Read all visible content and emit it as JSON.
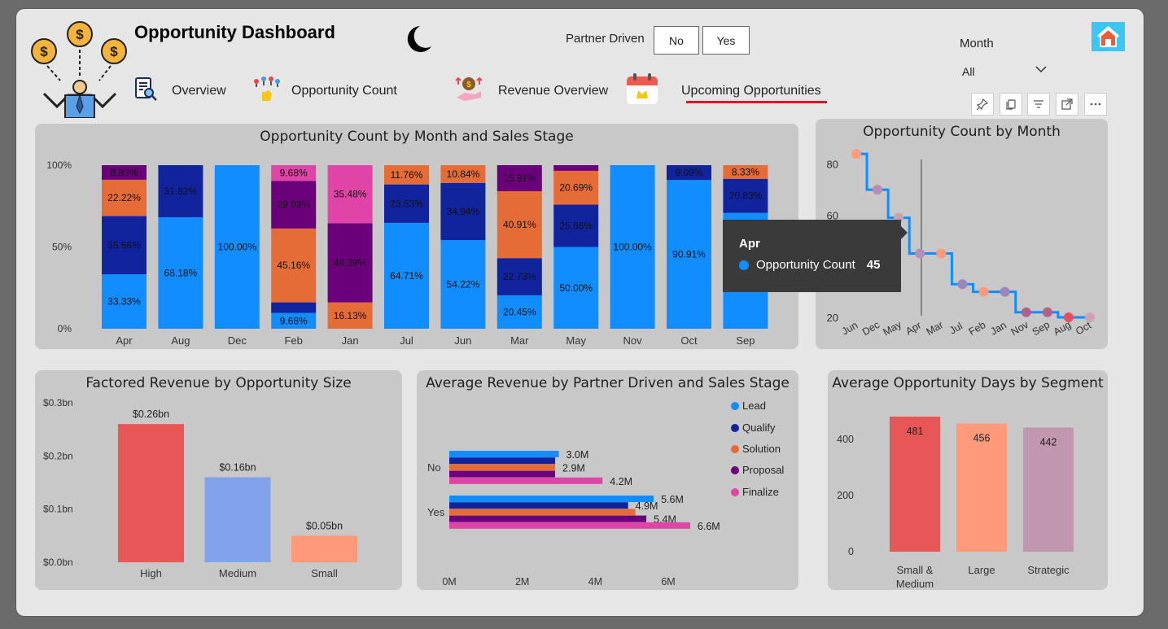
{
  "header": {
    "title": "Opportunity Dashboard",
    "partner_label": "Partner Driven",
    "partner_options": [
      "No",
      "Yes"
    ],
    "month_label": "Month",
    "month_value": "All"
  },
  "nav": {
    "items": [
      {
        "label": "Overview"
      },
      {
        "label": "Opportunity Count"
      },
      {
        "label": "Revenue Overview"
      },
      {
        "label": "Upcoming Opportunities"
      }
    ],
    "active_underline_color": "#e81123"
  },
  "icons": [
    "money-juggler-icon",
    "moon-icon",
    "report-search-icon",
    "hand-keys-icon",
    "revenue-hand-icon",
    "calendar-icon",
    "home-icon",
    "pin-icon",
    "copy-icon",
    "filter-icon",
    "focus-mode-icon",
    "more-options-icon"
  ],
  "colors": {
    "lead": "#118dff",
    "qualify": "#12239e",
    "solution": "#e66c37",
    "proposal": "#6b007b",
    "finalize": "#e044a7",
    "card_bg": "#c8c8c8"
  },
  "tooltip": {
    "month": "Apr",
    "measure": "Opportunity Count",
    "value": "45"
  },
  "chart_data": [
    {
      "id": "stacked",
      "type": "bar",
      "title": "Opportunity Count by Month and Sales Stage",
      "categories": [
        "Apr",
        "Aug",
        "Dec",
        "Feb",
        "Jan",
        "Jul",
        "Jun",
        "Mar",
        "May",
        "Nov",
        "Oct",
        "Sep"
      ],
      "yticks": [
        "0%",
        "50%",
        "100%"
      ],
      "series": [
        {
          "name": "Lead",
          "values": [
            33.33,
            68.18,
            100,
            9.68,
            0,
            64.71,
            54.22,
            20.45,
            50.0,
            100,
            90.91,
            70.84
          ],
          "labels": [
            "33.33%",
            "68.18%",
            "100.00%",
            "9.68%",
            "",
            "64.71%",
            "54.22%",
            "20.45%",
            "50.00%",
            "100.00%",
            "90.91%",
            ""
          ]
        },
        {
          "name": "Qualify",
          "values": [
            35.56,
            31.82,
            0,
            6.45,
            0,
            23.53,
            34.94,
            22.73,
            25.86,
            0,
            9.09,
            20.83
          ],
          "labels": [
            "35.56%",
            "31.82%",
            "",
            "",
            "",
            "23.53%",
            "34.94%",
            "22.73%",
            "25.86%",
            "",
            "9.09%",
            "20.83%"
          ]
        },
        {
          "name": "Solution",
          "values": [
            22.22,
            0,
            0,
            45.16,
            16.13,
            11.76,
            10.84,
            40.91,
            20.69,
            0,
            0,
            8.33
          ],
          "labels": [
            "22.22%",
            "",
            "",
            "45.16%",
            "16.13%",
            "11.76%",
            "10.84%",
            "40.91%",
            "20.69%",
            "",
            "",
            "8.33%"
          ]
        },
        {
          "name": "Proposal",
          "values": [
            8.89,
            0,
            0,
            29.03,
            48.39,
            0,
            0,
            15.91,
            3.45,
            0,
            0,
            0
          ],
          "labels": [
            "8.89%",
            "",
            "",
            "29.03%",
            "48.39%",
            "",
            "",
            "15.91%",
            "",
            "",
            "",
            ""
          ]
        },
        {
          "name": "Finalize",
          "values": [
            0,
            0,
            0,
            9.68,
            35.48,
            0,
            0,
            0,
            0,
            0,
            0,
            0
          ],
          "labels": [
            "",
            "",
            "",
            "9.68%",
            "35.48%",
            "",
            "",
            "",
            "",
            "",
            "",
            ""
          ]
        }
      ]
    },
    {
      "id": "steps",
      "type": "line",
      "title": "Opportunity Count by Month",
      "x": [
        "Jun",
        "Dec",
        "May",
        "Apr",
        "Mar",
        "Jul",
        "Feb",
        "Jan",
        "Nov",
        "Sep",
        "Aug",
        "Oct"
      ],
      "y": [
        84,
        70,
        59,
        45,
        45,
        33,
        30,
        30,
        22,
        22,
        20,
        20
      ],
      "yticks": [
        20,
        40,
        60,
        80
      ],
      "ylim": [
        20,
        85
      ]
    },
    {
      "id": "factored",
      "type": "bar",
      "title": "Factored Revenue by Opportunity Size",
      "categories": [
        "High",
        "Medium",
        "Small"
      ],
      "values": [
        0.26,
        0.16,
        0.05
      ],
      "labels": [
        "$0.26bn",
        "$0.16bn",
        "$0.05bn"
      ],
      "colors": [
        "#e85757",
        "#7fa2eb",
        "#fe9a7a"
      ],
      "yticks": [
        "$0.0bn",
        "$0.1bn",
        "$0.2bn",
        "$0.3bn"
      ],
      "ylim": [
        0,
        0.3
      ]
    },
    {
      "id": "avgrev",
      "type": "bar",
      "title": "Average Revenue by Partner Driven and Sales Stage",
      "categories": [
        "No",
        "Yes"
      ],
      "series": [
        {
          "name": "Lead",
          "values": [
            3.0,
            5.6
          ],
          "labels": [
            "3.0M",
            "5.6M"
          ]
        },
        {
          "name": "Qualify",
          "values": [
            2.9,
            4.9
          ],
          "labels": [
            "",
            "4.9M"
          ]
        },
        {
          "name": "Solution",
          "values": [
            2.9,
            5.1
          ],
          "labels": [
            "2.9M",
            ""
          ]
        },
        {
          "name": "Proposal",
          "values": [
            2.9,
            5.4
          ],
          "labels": [
            "",
            "5.4M"
          ]
        },
        {
          "name": "Finalize",
          "values": [
            4.2,
            6.6
          ],
          "labels": [
            "4.2M",
            "6.6M"
          ]
        }
      ],
      "xticks": [
        "0M",
        "2M",
        "4M",
        "6M"
      ],
      "xlim": [
        0,
        6
      ]
    },
    {
      "id": "days",
      "type": "bar",
      "title": "Average Opportunity Days by Segment",
      "categories": [
        "Small & Medium",
        "Large",
        "Strategic"
      ],
      "values": [
        481,
        456,
        442
      ],
      "colors": [
        "#e85757",
        "#fe9a7a",
        "#c197af"
      ],
      "yticks": [
        0,
        200,
        400
      ],
      "ylim": [
        0,
        481
      ]
    }
  ]
}
